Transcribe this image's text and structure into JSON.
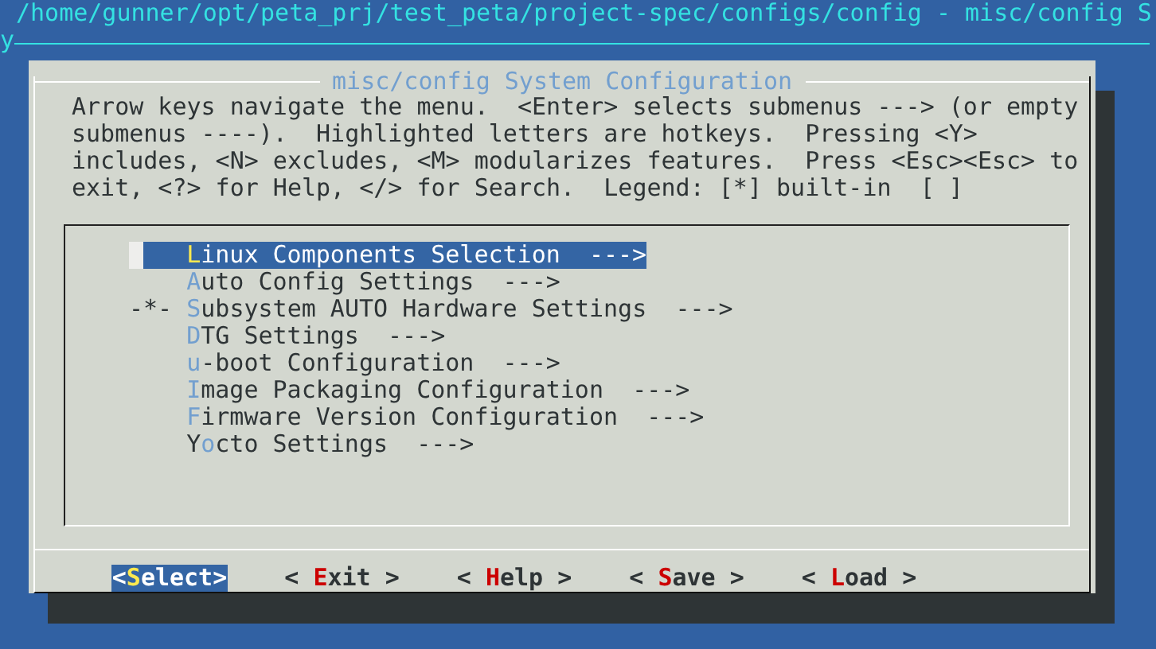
{
  "terminal": {
    "title_line": "/home/gunner/opt/peta_prj/test_peta/project-spec/configs/config - misc/config S",
    "wrapped_line": "y"
  },
  "dialog": {
    "title": "misc/config System Configuration",
    "help_text": "Arrow keys navigate the menu.  <Enter> selects submenus ---> (or empty submenus ----).  Highlighted letters are hotkeys.  Pressing <Y> includes, <N> excludes, <M> modularizes features.  Press <Esc><Esc> to exit, <?> for Help, </> for Search.  Legend: [*] built-in  [ ]",
    "menu_items": [
      {
        "key": "L",
        "post": "inux Components Selection",
        "arrow": "--->",
        "selected": true
      },
      {
        "key": "A",
        "post": "uto Config Settings",
        "arrow": "--->",
        "selected": false
      },
      {
        "prefix": "-*-",
        "key": "S",
        "post": "ubsystem AUTO Hardware Settings",
        "arrow": "--->",
        "selected": false
      },
      {
        "key": "D",
        "post": "TG Settings",
        "arrow": "--->",
        "selected": false
      },
      {
        "key": "u",
        "post": "-boot Configuration",
        "arrow": "--->",
        "selected": false
      },
      {
        "key": "I",
        "post": "mage Packaging Configuration",
        "arrow": "--->",
        "selected": false
      },
      {
        "key": "F",
        "post": "irmware Version Configuration",
        "arrow": "--->",
        "selected": false
      },
      {
        "pre": "Y",
        "key": "o",
        "post": "cto Settings",
        "arrow": "--->",
        "selected": false
      }
    ],
    "buttons": [
      {
        "pre": "<",
        "key": "S",
        "post": "elect>",
        "selected": true
      },
      {
        "pre": "< ",
        "key": "E",
        "post": "xit >",
        "selected": false
      },
      {
        "pre": "< ",
        "key": "H",
        "post": "elp >",
        "selected": false
      },
      {
        "pre": "< ",
        "key": "S",
        "post": "ave >",
        "selected": false
      },
      {
        "pre": "< ",
        "key": "L",
        "post": "oad >",
        "selected": false
      }
    ]
  }
}
